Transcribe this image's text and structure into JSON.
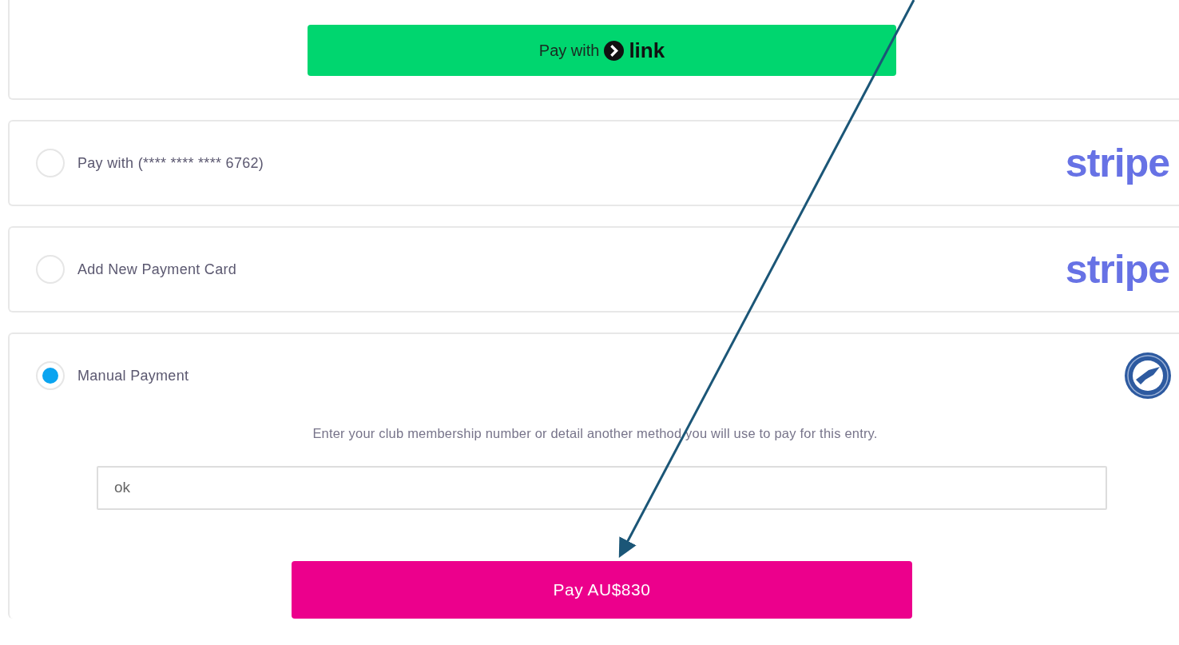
{
  "link_button": {
    "prefix": "Pay with",
    "brand": "link"
  },
  "methods": [
    {
      "label": "Pay with (**** **** **** 6762)",
      "selected": false,
      "logo": {
        "kind": "wordmark",
        "text": "stripe"
      }
    },
    {
      "label": "Add New Payment Card",
      "selected": false,
      "logo": {
        "kind": "wordmark",
        "text": "stripe"
      }
    },
    {
      "label": "Manual Payment",
      "selected": true,
      "logo": {
        "kind": "emblem"
      },
      "instructions": "Enter your club membership number or detail another method you will use to pay for this entry.",
      "input": {
        "value": "ok"
      },
      "submit": {
        "label": "Pay AU$830"
      }
    }
  ]
}
